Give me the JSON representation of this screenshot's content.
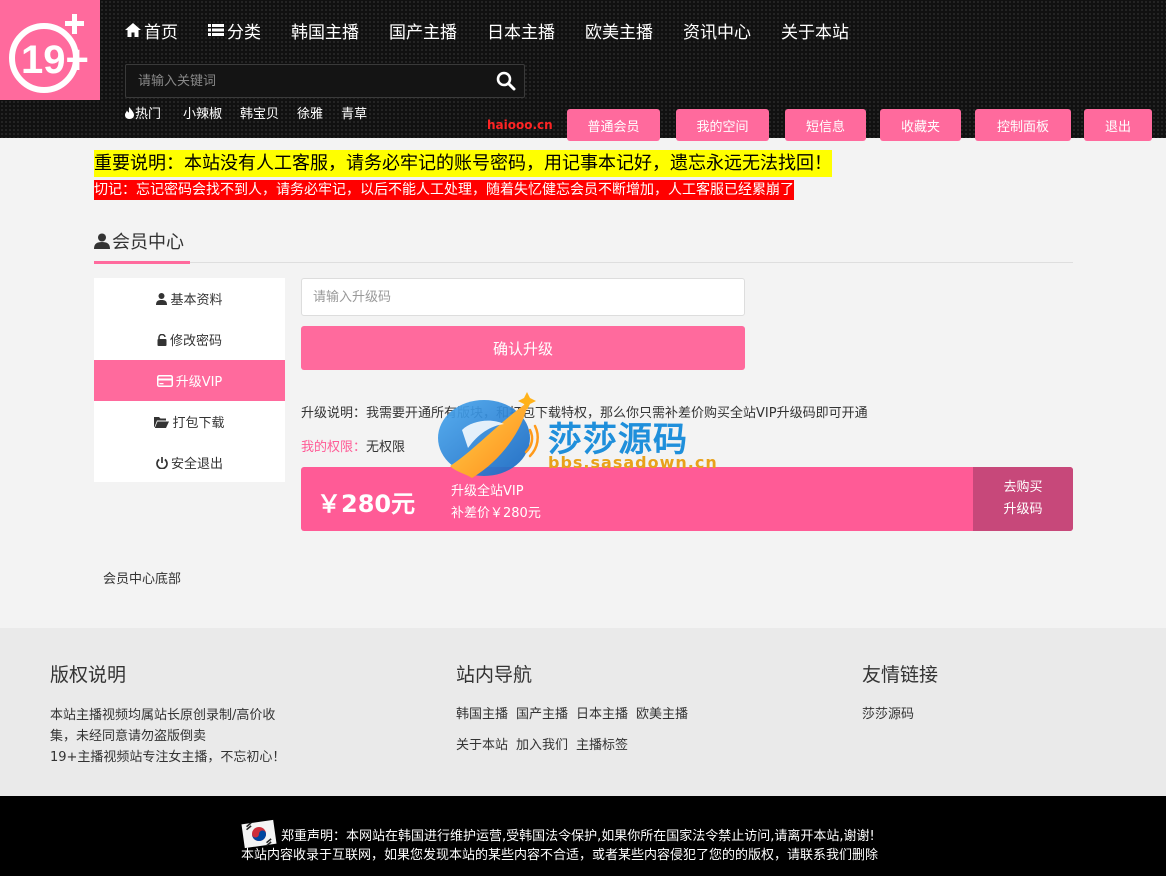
{
  "header": {
    "logo_text": "19+",
    "nav": [
      {
        "label": "首页",
        "icon": "home-icon"
      },
      {
        "label": "分类",
        "icon": "list-icon"
      },
      {
        "label": "韩国主播"
      },
      {
        "label": "国产主播"
      },
      {
        "label": "日本主播"
      },
      {
        "label": "欧美主播"
      },
      {
        "label": "资讯中心"
      },
      {
        "label": "关于本站"
      }
    ],
    "search": {
      "placeholder": "请输入关键词"
    },
    "hot_label": "热门",
    "hot_tags": [
      "小辣椒",
      "韩宝贝",
      "徐雅",
      "青草"
    ],
    "brand": "haiooo.cn",
    "member_buttons": [
      "普通会员",
      "我的空间",
      "短信息",
      "收藏夹",
      "控制面板",
      "退出"
    ]
  },
  "notices": {
    "main": "重要说明：本站没有人工客服，请务必牢记的账号密码，用记事本记好，遗忘永远无法找回！",
    "warning": "切记：忘记密码会找不到人，请务必牢记，以后不能人工处理，随着失忆健忘会员不断增加，人工客服已经累崩了"
  },
  "member_center": {
    "title": "会员中心",
    "sidebar": [
      {
        "label": "基本资料",
        "icon": "user-icon"
      },
      {
        "label": "修改密码",
        "icon": "unlock-icon"
      },
      {
        "label": "升级VIP",
        "icon": "credit-card-icon",
        "active": true
      },
      {
        "label": "打包下载",
        "icon": "folder-open-icon"
      },
      {
        "label": "安全退出",
        "icon": "power-icon"
      }
    ],
    "upgrade_input_placeholder": "请输入升级码",
    "confirm_label": "确认升级",
    "upgrade_desc": "升级说明：我需要开通所有版块，和打包下载特权，那么你只需补差价购买全站VIP升级码即可开通",
    "permission_label": "我的权限：",
    "permission_value": "无权限",
    "vip_card": {
      "price": "￥280元",
      "name": "升级全站VIP",
      "diff": "补差价￥280元",
      "buy_line1": "去购买",
      "buy_line2": "升级码"
    },
    "bottom_text": "会员中心底部"
  },
  "watermark": {
    "title": "莎莎源码",
    "sub": "bbs.sasadown.cn"
  },
  "footer": {
    "copyright_title": "版权说明",
    "copyright_text": "本站主播视频均属站长原创录制/高价收集，未经同意请勿盗版倒卖",
    "copyright_text2": "19+主播视频站专注女主播，不忘初心！",
    "nav_title": "站内导航",
    "nav_links": [
      "韩国主播",
      "国产主播",
      "日本主播",
      "欧美主播",
      "关于本站",
      "加入我们",
      "主播标签"
    ],
    "friends_title": "友情链接",
    "friend_links": [
      "莎莎源码"
    ]
  },
  "bottom_bar": {
    "line1": "郑重声明：本网站在韩国进行维护运营,受韩国法令保护,如果你所在国家法令禁止访问,请离开本站,谢谢!",
    "line2": "本站内容收录于互联网，如果您发现本站的某些内容不合适，或者某些内容侵犯了您的的版权，请联系我们删除"
  },
  "colors": {
    "accent": "#ff6a9d",
    "header_bg": "#111111",
    "notice_yellow": "#ffff00",
    "notice_red": "#ff0000"
  }
}
